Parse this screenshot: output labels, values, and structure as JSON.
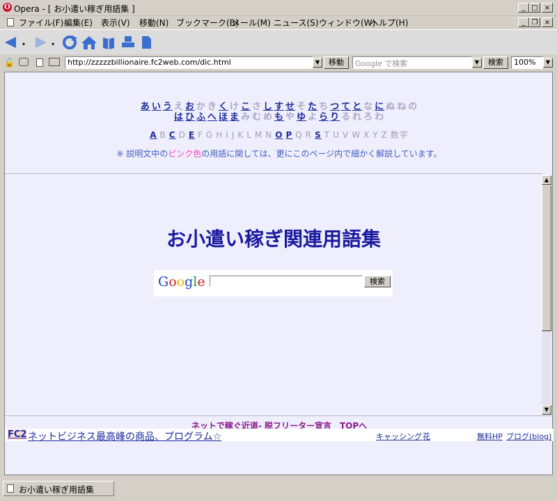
{
  "window": {
    "title": "Opera - [ お小遣い稼ぎ用語集 ]",
    "logo_glyph": "O",
    "min_glyph": "_",
    "max_glyph": "□",
    "close_glyph": "×",
    "restore_glyph": "❐"
  },
  "menu": {
    "items": [
      "ファイル(F)",
      "編集(E)",
      "表示(V)",
      "移動(N)",
      "ブックマーク(B)",
      "メール(M)",
      "ニュース(S)",
      "ウィンドウ(W)",
      "ヘルプ(H)"
    ]
  },
  "address": {
    "url": "http://zzzzzbillionaire.fc2web.com/dic.html",
    "go_label": "移動",
    "search_placeholder": "Google で検索",
    "search_button": "検索",
    "zoom": "100%"
  },
  "kana": {
    "row1": [
      {
        "c": "あ",
        "on": true
      },
      {
        "c": "い",
        "on": true
      },
      {
        "c": "う",
        "on": true
      },
      {
        "c": "え",
        "on": false
      },
      {
        "c": "お",
        "on": true
      },
      {
        "c": "か",
        "on": false
      },
      {
        "c": "き",
        "on": false
      },
      {
        "c": "く",
        "on": true
      },
      {
        "c": "け",
        "on": false
      },
      {
        "c": "こ",
        "on": true
      },
      {
        "c": "さ",
        "on": false
      },
      {
        "c": "し",
        "on": true
      },
      {
        "c": "す",
        "on": true
      },
      {
        "c": "せ",
        "on": true
      },
      {
        "c": "そ",
        "on": false
      },
      {
        "c": "た",
        "on": true
      },
      {
        "c": "ち",
        "on": false
      },
      {
        "c": "つ",
        "on": true
      },
      {
        "c": "て",
        "on": true
      },
      {
        "c": "と",
        "on": true
      },
      {
        "c": "な",
        "on": false
      },
      {
        "c": "に",
        "on": true
      },
      {
        "c": "ぬ",
        "on": false
      },
      {
        "c": "ね",
        "on": false
      },
      {
        "c": "の",
        "on": false
      }
    ],
    "row2": [
      {
        "c": "は",
        "on": true
      },
      {
        "c": "ひ",
        "on": true
      },
      {
        "c": "ふ",
        "on": true
      },
      {
        "c": "へ",
        "on": true
      },
      {
        "c": "ほ",
        "on": true
      },
      {
        "c": "ま",
        "on": true
      },
      {
        "c": "み",
        "on": false
      },
      {
        "c": "む",
        "on": false
      },
      {
        "c": "め",
        "on": false
      },
      {
        "c": "も",
        "on": true
      },
      {
        "c": "や",
        "on": false
      },
      {
        "c": "ゆ",
        "on": true
      },
      {
        "c": "よ",
        "on": false
      },
      {
        "c": "ら",
        "on": true
      },
      {
        "c": "り",
        "on": true
      },
      {
        "c": "る",
        "on": false
      },
      {
        "c": "れ",
        "on": false
      },
      {
        "c": "ろ",
        "on": false
      },
      {
        "c": "わ",
        "on": false
      }
    ]
  },
  "alphabet": [
    {
      "c": "A",
      "on": true
    },
    {
      "c": "B",
      "on": false
    },
    {
      "c": "C",
      "on": true
    },
    {
      "c": "D",
      "on": false
    },
    {
      "c": "E",
      "on": true
    },
    {
      "c": "F",
      "on": false
    },
    {
      "c": "G",
      "on": false
    },
    {
      "c": "H",
      "on": false
    },
    {
      "c": "I",
      "on": false
    },
    {
      "c": "J",
      "on": false
    },
    {
      "c": "K",
      "on": false
    },
    {
      "c": "L",
      "on": false
    },
    {
      "c": "M",
      "on": false
    },
    {
      "c": "N",
      "on": false
    },
    {
      "c": "O",
      "on": true
    },
    {
      "c": "P",
      "on": true
    },
    {
      "c": "Q",
      "on": false
    },
    {
      "c": "R",
      "on": false
    },
    {
      "c": "S",
      "on": true
    },
    {
      "c": "T",
      "on": false
    },
    {
      "c": "U",
      "on": false
    },
    {
      "c": "V",
      "on": false
    },
    {
      "c": "W",
      "on": false
    },
    {
      "c": "X",
      "on": false
    },
    {
      "c": "Y",
      "on": false
    },
    {
      "c": "Z",
      "on": false
    },
    {
      "c": "数字",
      "on": false
    }
  ],
  "note": {
    "prefix": "※ 説明文中の",
    "pink": "ピンク色",
    "suffix": "の用語に関しては、更にこのページ内で細かく解説しています。"
  },
  "page": {
    "title": "お小遣い稼ぎ関連用語集",
    "google_logo": "Google",
    "search_button": "検索",
    "footer_link": "ネットで稼ぐ近道- 脱フリーター宣言　TOPへ"
  },
  "ad": {
    "fc2": "FC2",
    "main": "ネットビジネス最高峰の商品、プログラム☆",
    "link1": "キャッシング",
    "link2": "花",
    "link3": "無料HP",
    "link4": "ブログ(blog)"
  },
  "status": {
    "tab_label": "お小遣い稼ぎ用語集"
  },
  "colors": {
    "content_bg": "#efeefc",
    "link_blue": "#1a2a9a",
    "title_blue": "#1a1aa0",
    "pink": "#ff40c0",
    "footer_purple": "#8a1a8a"
  }
}
